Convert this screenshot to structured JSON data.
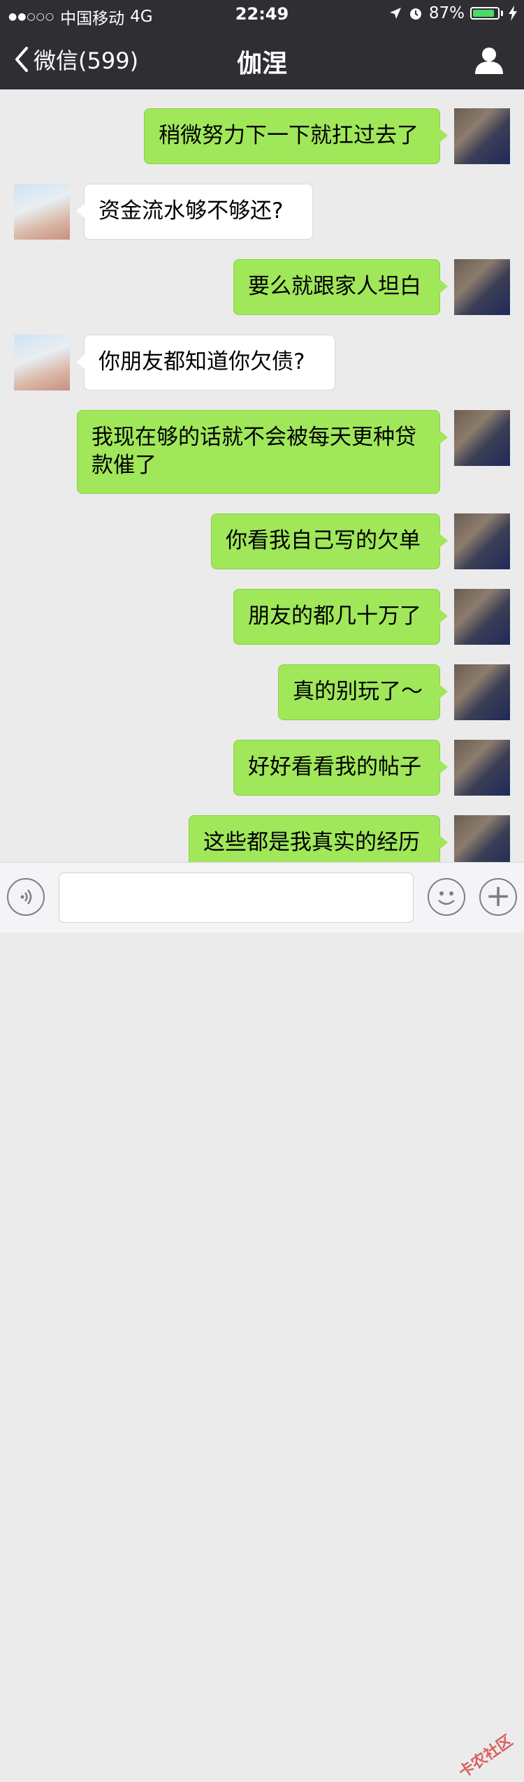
{
  "status_bar": {
    "signal": "●●○○○",
    "carrier": "中国移动",
    "network": "4G",
    "time": "22:49",
    "battery_percent": "87%",
    "battery_level": 0.87,
    "battery_color": "#4cd964",
    "icons": [
      "location-icon",
      "alarm-icon",
      "charging-icon"
    ]
  },
  "nav": {
    "back_label": "微信(599)",
    "title": "伽涅",
    "profile_icon": "person-icon"
  },
  "messages": [
    {
      "from": "me",
      "text": "稍微努力下一下就扛过去了"
    },
    {
      "from": "her",
      "text": "资金流水够不够还?"
    },
    {
      "from": "me",
      "text": "要么就跟家人坦白"
    },
    {
      "from": "her",
      "text": "你朋友都知道你欠债?"
    },
    {
      "from": "me",
      "text": "我现在够的话就不会被每天更种贷款催了"
    },
    {
      "from": "me",
      "text": "你看我自己写的欠单"
    },
    {
      "from": "me",
      "text": "朋友的都几十万了"
    },
    {
      "from": "me",
      "text": "真的别玩了～"
    },
    {
      "from": "me",
      "text": "好好看看我的帖子"
    },
    {
      "from": "me",
      "text": "这些都是我真实的经历"
    }
  ],
  "input_bar": {
    "placeholder": "",
    "voice_icon": "voice-icon",
    "emoji_icon": "emoji-icon",
    "plus_icon": "plus-icon"
  },
  "watermark": "卡农社区",
  "colors": {
    "my_bubble": "#a0e75a",
    "her_bubble": "#ffffff",
    "nav_bg": "#2e2e33",
    "chat_bg": "#ebebeb"
  }
}
